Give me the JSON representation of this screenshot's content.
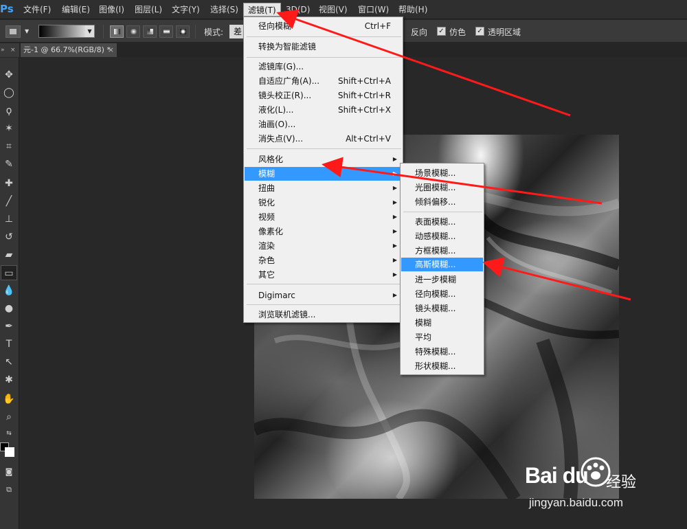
{
  "app": {
    "logo": "Ps"
  },
  "menubar": {
    "items": [
      {
        "label": "文件(F)"
      },
      {
        "label": "编辑(E)"
      },
      {
        "label": "图像(I)"
      },
      {
        "label": "图层(L)"
      },
      {
        "label": "文字(Y)"
      },
      {
        "label": "选择(S)"
      },
      {
        "label": "滤镜(T)"
      },
      {
        "label": "3D(D)"
      },
      {
        "label": "视图(V)"
      },
      {
        "label": "窗口(W)"
      },
      {
        "label": "帮助(H)"
      }
    ]
  },
  "options": {
    "mode_label": "模式:",
    "mode_value": "差",
    "reverse_label": "反向",
    "dither_label": "仿色",
    "transparency_label": "透明区域",
    "dither_checked": true,
    "transparency_checked": true
  },
  "document": {
    "tab_title": "元-1 @ 66.7%(RGB/8) *",
    "close": "×"
  },
  "toolbar": {
    "collapse": "»",
    "close": "×"
  },
  "filter_menu": {
    "items": [
      {
        "label": "径向模糊",
        "shortcut": "Ctrl+F"
      },
      {
        "label": "转换为智能滤镜"
      },
      {
        "label": "滤镜库(G)..."
      },
      {
        "label": "自适应广角(A)...",
        "shortcut": "Shift+Ctrl+A"
      },
      {
        "label": "镜头校正(R)...",
        "shortcut": "Shift+Ctrl+R"
      },
      {
        "label": "液化(L)...",
        "shortcut": "Shift+Ctrl+X"
      },
      {
        "label": "油画(O)..."
      },
      {
        "label": "消失点(V)...",
        "shortcut": "Alt+Ctrl+V"
      },
      {
        "label": "风格化"
      },
      {
        "label": "模糊"
      },
      {
        "label": "扭曲"
      },
      {
        "label": "锐化"
      },
      {
        "label": "视频"
      },
      {
        "label": "像素化"
      },
      {
        "label": "渲染"
      },
      {
        "label": "杂色"
      },
      {
        "label": "其它"
      },
      {
        "label": "Digimarc"
      },
      {
        "label": "浏览联机滤镜..."
      }
    ],
    "submenu_arrow": "▶"
  },
  "blur_menu": {
    "items": [
      {
        "label": "场景模糊..."
      },
      {
        "label": "光圈模糊..."
      },
      {
        "label": "倾斜偏移..."
      },
      {
        "label": "表面模糊..."
      },
      {
        "label": "动感模糊..."
      },
      {
        "label": "方框模糊..."
      },
      {
        "label": "高斯模糊..."
      },
      {
        "label": "进一步模糊"
      },
      {
        "label": "径向模糊..."
      },
      {
        "label": "镜头模糊..."
      },
      {
        "label": "模糊"
      },
      {
        "label": "平均"
      },
      {
        "label": "特殊模糊..."
      },
      {
        "label": "形状模糊..."
      }
    ]
  },
  "watermark": {
    "brand": "Bai du",
    "service": "经验",
    "url": "jingyan.baidu.com"
  },
  "colors": {
    "highlight": "#3399ff",
    "annotation_arrow": "#ff1a1a",
    "menu_bg": "#f0f0f0"
  }
}
